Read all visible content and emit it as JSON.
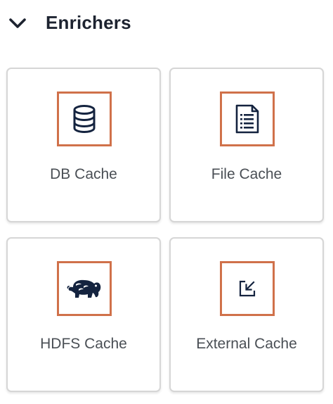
{
  "section": {
    "title": "Enrichers",
    "chevron_icon": "chevron-down-icon",
    "expanded": true
  },
  "colors": {
    "title": "#1d2330",
    "label": "#4a4f55",
    "icon_frame": "#d0714a",
    "icon": "#14233f",
    "card_border": "#d6d6d6"
  },
  "cards": [
    {
      "label": "DB Cache",
      "icon": "database-icon"
    },
    {
      "label": "File Cache",
      "icon": "document-list-icon"
    },
    {
      "label": "HDFS Cache",
      "icon": "hadoop-elephant-icon"
    },
    {
      "label": "External Cache",
      "icon": "external-import-icon"
    }
  ]
}
